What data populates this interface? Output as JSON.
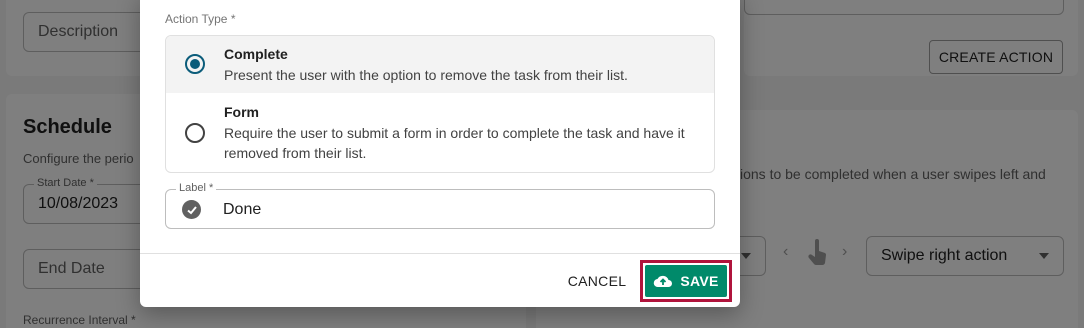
{
  "background": {
    "description_placeholder": "Description",
    "create_action_label": "CREATE ACTION",
    "schedule_title": "Schedule",
    "schedule_desc": "Configure the perio",
    "start_date_label": "Start Date *",
    "start_date_value": "10/08/2023",
    "end_date_placeholder": "End Date",
    "recurrence_label": "Recurrence Interval *",
    "swipe_desc": "ions to be completed when a user swipes left and",
    "swipe_right_label": "Swipe right action"
  },
  "modal": {
    "action_type_label": "Action Type *",
    "options": [
      {
        "title": "Complete",
        "description": "Present the user with the option to remove the task from their list.",
        "selected": true
      },
      {
        "title": "Form",
        "description": "Require the user to submit a form in order to complete the task and have it removed from their list.",
        "selected": false
      }
    ],
    "label_field": {
      "label": "Label *",
      "value": "Done",
      "icon": "check-circle-icon"
    },
    "cancel_label": "CANCEL",
    "save_label": "SAVE",
    "save_icon": "cloud-upload-icon",
    "colors": {
      "primary": "#008a6a",
      "radio": "#0b5c7a",
      "highlight": "#b0143c"
    }
  }
}
